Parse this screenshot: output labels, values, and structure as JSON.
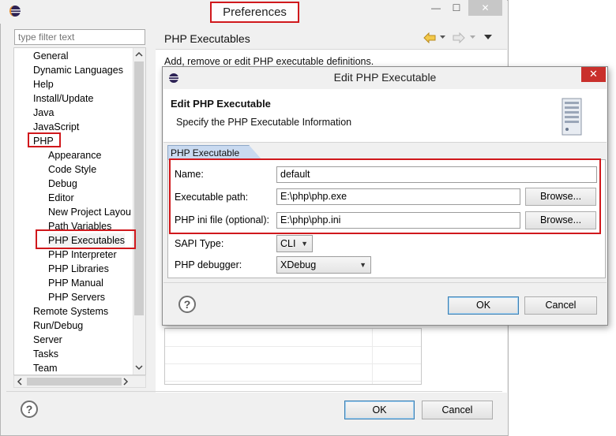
{
  "window": {
    "title": "Preferences",
    "controls": {
      "minimize": "—",
      "maximize": "☐",
      "close": "✕"
    }
  },
  "filter": {
    "placeholder": "type filter text"
  },
  "tree": {
    "items": [
      {
        "label": "General",
        "level": 0
      },
      {
        "label": "Dynamic Languages",
        "level": 0
      },
      {
        "label": "Help",
        "level": 0
      },
      {
        "label": "Install/Update",
        "level": 0
      },
      {
        "label": "Java",
        "level": 0
      },
      {
        "label": "JavaScript",
        "level": 0
      },
      {
        "label": "PHP",
        "level": 0
      },
      {
        "label": "Appearance",
        "level": 1
      },
      {
        "label": "Code Style",
        "level": 1
      },
      {
        "label": "Debug",
        "level": 1
      },
      {
        "label": "Editor",
        "level": 1
      },
      {
        "label": "New Project Layou",
        "level": 1
      },
      {
        "label": "Path Variables",
        "level": 1
      },
      {
        "label": "PHP Executables",
        "level": 1,
        "selected": true
      },
      {
        "label": "PHP Interpreter",
        "level": 1
      },
      {
        "label": "PHP Libraries",
        "level": 1
      },
      {
        "label": "PHP Manual",
        "level": 1
      },
      {
        "label": "PHP Servers",
        "level": 1
      },
      {
        "label": "Remote Systems",
        "level": 0
      },
      {
        "label": "Run/Debug",
        "level": 0
      },
      {
        "label": "Server",
        "level": 0
      },
      {
        "label": "Tasks",
        "level": 0
      },
      {
        "label": "Team",
        "level": 0
      }
    ]
  },
  "page": {
    "title": "PHP Executables",
    "description": "Add, remove or edit PHP executable definitions."
  },
  "footer": {
    "help": "?",
    "ok": "OK",
    "cancel": "Cancel"
  },
  "dialog": {
    "title": "Edit PHP Executable",
    "close": "✕",
    "header_title": "Edit PHP Executable",
    "header_desc": "Specify the PHP Executable Information",
    "tab": "PHP Executable",
    "fields": {
      "name_label": "Name:",
      "name_value": "default",
      "exe_label": "Executable path:",
      "exe_value": "E:\\php\\php.exe",
      "ini_label": "PHP ini file (optional):",
      "ini_value": "E:\\php\\php.ini",
      "browse": "Browse...",
      "sapi_label": "SAPI Type:",
      "sapi_value": "CLI",
      "debugger_label": "PHP debugger:",
      "debugger_value": "XDebug"
    },
    "help": "?",
    "ok": "OK",
    "cancel": "Cancel"
  },
  "colors": {
    "highlight_border": "#d0181c",
    "tab_bg": "#c9daf0",
    "default_button_border": "#3c7fb1"
  }
}
